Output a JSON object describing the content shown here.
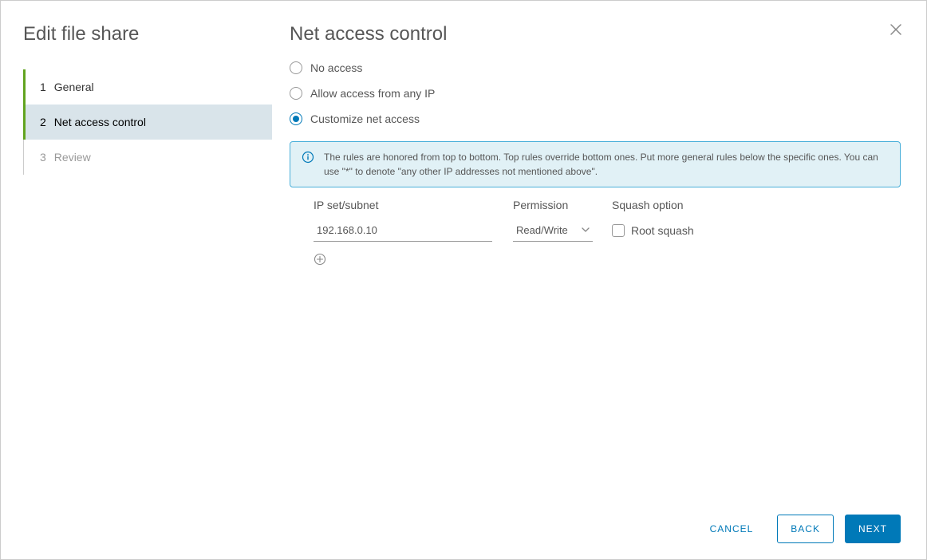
{
  "dialog": {
    "title": "Edit file share"
  },
  "steps": {
    "items": [
      {
        "num": "1",
        "label": "General"
      },
      {
        "num": "2",
        "label": "Net access control"
      },
      {
        "num": "3",
        "label": "Review"
      }
    ]
  },
  "main": {
    "title": "Net access control",
    "options": {
      "no_access": "No access",
      "allow_any": "Allow access from any IP",
      "customize": "Customize net access"
    },
    "info": "The rules are honored from top to bottom. Top rules override bottom ones. Put more general rules below the specific ones. You can use \"*\" to denote \"any other IP addresses not mentioned above\".",
    "headers": {
      "ip": "IP set/subnet",
      "perm": "Permission",
      "squash": "Squash option"
    },
    "rules": [
      {
        "ip": "192.168.0.10",
        "perm": "Read/Write",
        "squash_label": "Root squash",
        "squash_checked": false
      }
    ]
  },
  "footer": {
    "cancel": "Cancel",
    "back": "Back",
    "next": "Next"
  }
}
